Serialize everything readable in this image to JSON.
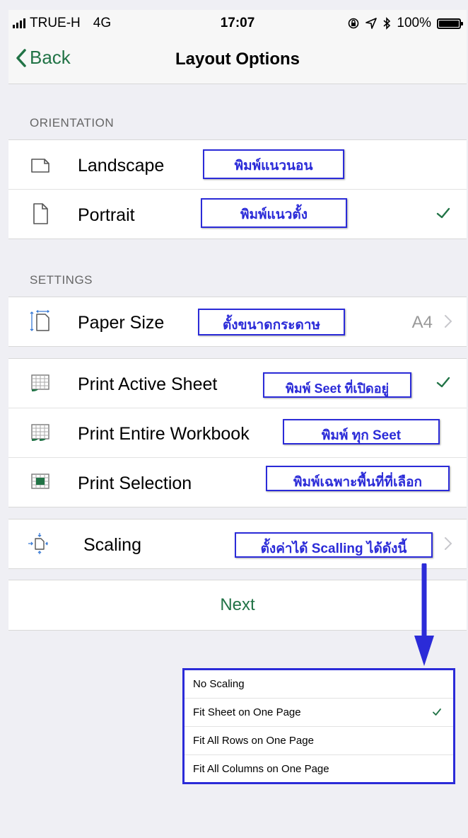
{
  "status": {
    "carrier": "TRUE-H",
    "network": "4G",
    "time": "17:07",
    "battery": "100%"
  },
  "nav": {
    "back_label": "Back",
    "title": "Layout Options"
  },
  "orientation": {
    "header": "ORIENTATION",
    "items": [
      {
        "label": "Landscape",
        "note": "พิมพ์แนวนอน",
        "checked": false
      },
      {
        "label": "Portrait",
        "note": "พิมพ์แนวตั้ง",
        "checked": true
      }
    ]
  },
  "settings": {
    "header": "SETTINGS",
    "paper": {
      "label": "Paper Size",
      "note": "ตั้งขนาดกระดาษ",
      "value": "A4"
    },
    "print_items": [
      {
        "label": "Print Active Sheet",
        "note": "พิมพ์ Seet ที่เปิดอยู่",
        "checked": true
      },
      {
        "label": "Print Entire Workbook",
        "note": "พิมพ์ ทุก Seet",
        "checked": false
      },
      {
        "label": "Print Selection",
        "note": "พิมพ์เฉพาะพื้นที่ที่เลือก",
        "checked": false
      }
    ],
    "scaling": {
      "label": "Scaling",
      "note": "ตั้งค่าได้ Scalling ได้ดังนี้"
    }
  },
  "next_label": "Next",
  "scaling_options": [
    {
      "label": "No Scaling",
      "checked": false
    },
    {
      "label": "Fit Sheet on One Page",
      "checked": true
    },
    {
      "label": "Fit All Rows on One Page",
      "checked": false
    },
    {
      "label": "Fit All Columns on One Page",
      "checked": false
    }
  ],
  "colors": {
    "accent": "#217346",
    "annotation": "#2b2bd8"
  },
  "icons": {
    "landscape": "page-landscape-icon",
    "portrait": "page-portrait-icon",
    "paper": "paper-size-icon",
    "sheet": "sheet-grid-icon",
    "scaling": "scaling-icon",
    "check": "checkmark-icon",
    "chevron": "chevron-right-icon"
  }
}
